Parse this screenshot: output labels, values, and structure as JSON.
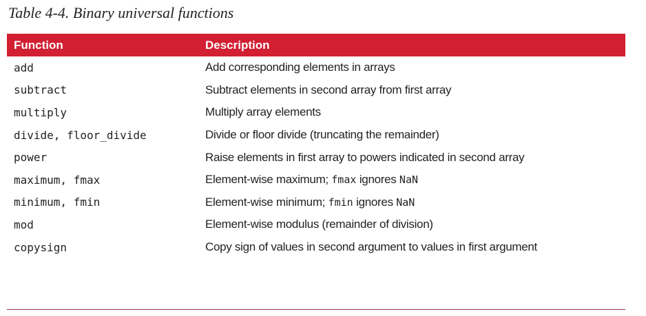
{
  "caption": "Table 4-4. Binary universal functions",
  "headers": {
    "function": "Function",
    "description": "Description"
  },
  "rows": [
    {
      "function": "add",
      "description": "Add corresponding elements in arrays"
    },
    {
      "function": "subtract",
      "description": "Subtract elements in second array from first array"
    },
    {
      "function": "multiply",
      "description": "Multiply array elements"
    },
    {
      "function": "divide, floor_divide",
      "description": "Divide or floor divide (truncating the remainder)"
    },
    {
      "function": "power",
      "description": "Raise elements in first array to powers indicated in second array"
    },
    {
      "function": "maximum, fmax",
      "description_parts": [
        "Element-wise maximum; ",
        "fmax",
        " ignores ",
        "NaN"
      ]
    },
    {
      "function": "minimum, fmin",
      "description_parts": [
        "Element-wise minimum; ",
        "fmin",
        " ignores ",
        "NaN"
      ]
    },
    {
      "function": "mod",
      "description": "Element-wise modulus (remainder of division)"
    },
    {
      "function": "copysign",
      "description": "Copy sign of values in second argument to values in first argument"
    }
  ]
}
